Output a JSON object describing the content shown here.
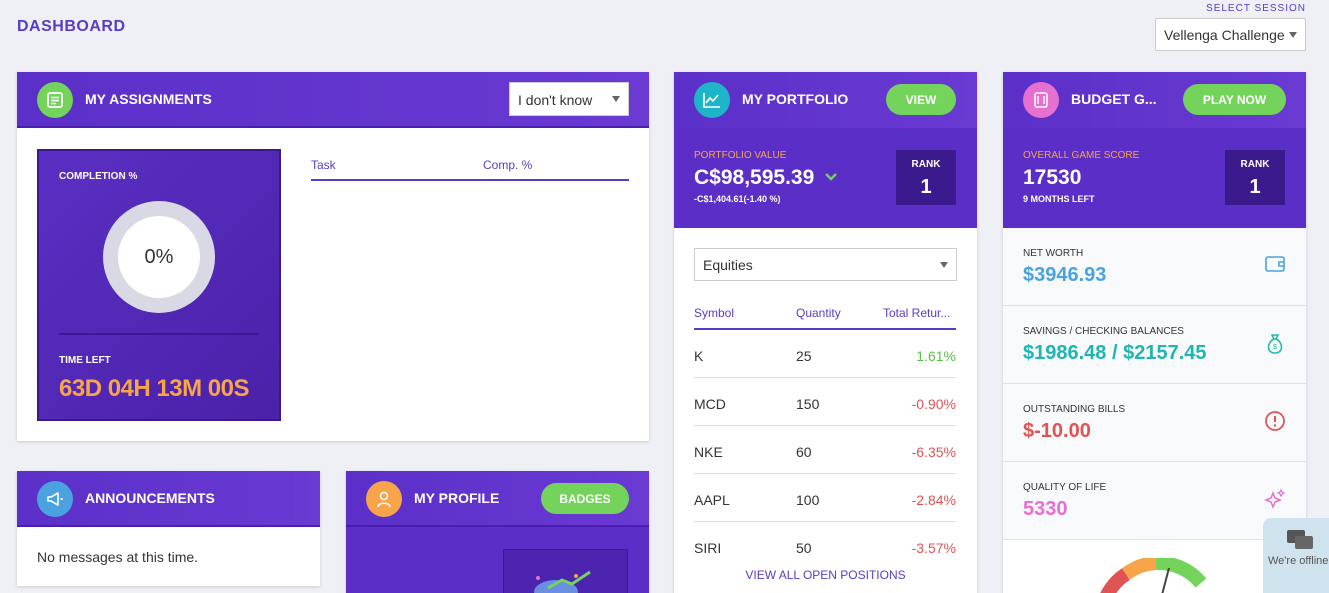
{
  "page": {
    "title": "DASHBOARD"
  },
  "session": {
    "label": "SELECT SESSION",
    "selected": "Vellenga Challenge"
  },
  "assignments": {
    "title": "MY ASSIGNMENTS",
    "filter": "I don't know",
    "completion_label": "COMPLETION %",
    "completion_value": "0%",
    "time_left_label": "TIME LEFT",
    "time_left_value": "63D 04H 13M 00S",
    "columns": [
      "Task",
      "Comp. %"
    ]
  },
  "portfolio": {
    "title": "MY PORTFOLIO",
    "view_label": "VIEW",
    "value_label": "PORTFOLIO VALUE",
    "value": "C$98,595.39",
    "change": "-C$1,404.61(-1.40 %)",
    "rank_label": "RANK",
    "rank": "1",
    "asset_class": "Equities",
    "columns": [
      "Symbol",
      "Quantity",
      "Total Retur..."
    ],
    "rows": [
      {
        "symbol": "K",
        "quantity": "25",
        "return": "1.61%"
      },
      {
        "symbol": "MCD",
        "quantity": "150",
        "return": "-0.90%"
      },
      {
        "symbol": "NKE",
        "quantity": "60",
        "return": "-6.35%"
      },
      {
        "symbol": "AAPL",
        "quantity": "100",
        "return": "-2.84%"
      },
      {
        "symbol": "SIRI",
        "quantity": "50",
        "return": "-3.57%"
      }
    ],
    "view_all": "VIEW ALL OPEN POSITIONS"
  },
  "budget": {
    "title": "BUDGET G...",
    "play_label": "PLAY NOW",
    "score_label": "OVERALL GAME SCORE",
    "score": "17530",
    "months_left": "9 MONTHS LEFT",
    "rank_label": "RANK",
    "rank": "1",
    "net_worth_label": "NET WORTH",
    "net_worth": "$3946.93",
    "savings_label": "SAVINGS / CHECKING BALANCES",
    "savings": "$1986.48 / $2157.45",
    "bills_label": "OUTSTANDING BILLS",
    "bills": "$-10.00",
    "qol_label": "QUALITY OF LIFE",
    "qol": "5330"
  },
  "announcements": {
    "title": "ANNOUNCEMENTS",
    "message": "No messages at this time."
  },
  "profile": {
    "title": "MY PROFILE",
    "badges_label": "BADGES"
  },
  "chat": {
    "status": "We're offline"
  },
  "colors": {
    "primary": "#5b30c8",
    "accent_green": "#73d35a",
    "orange": "#f7a44b",
    "blue_value": "#4aa3df",
    "teal_value": "#1fb5b0",
    "red_value": "#e05454",
    "pink_value": "#e66fd0"
  }
}
